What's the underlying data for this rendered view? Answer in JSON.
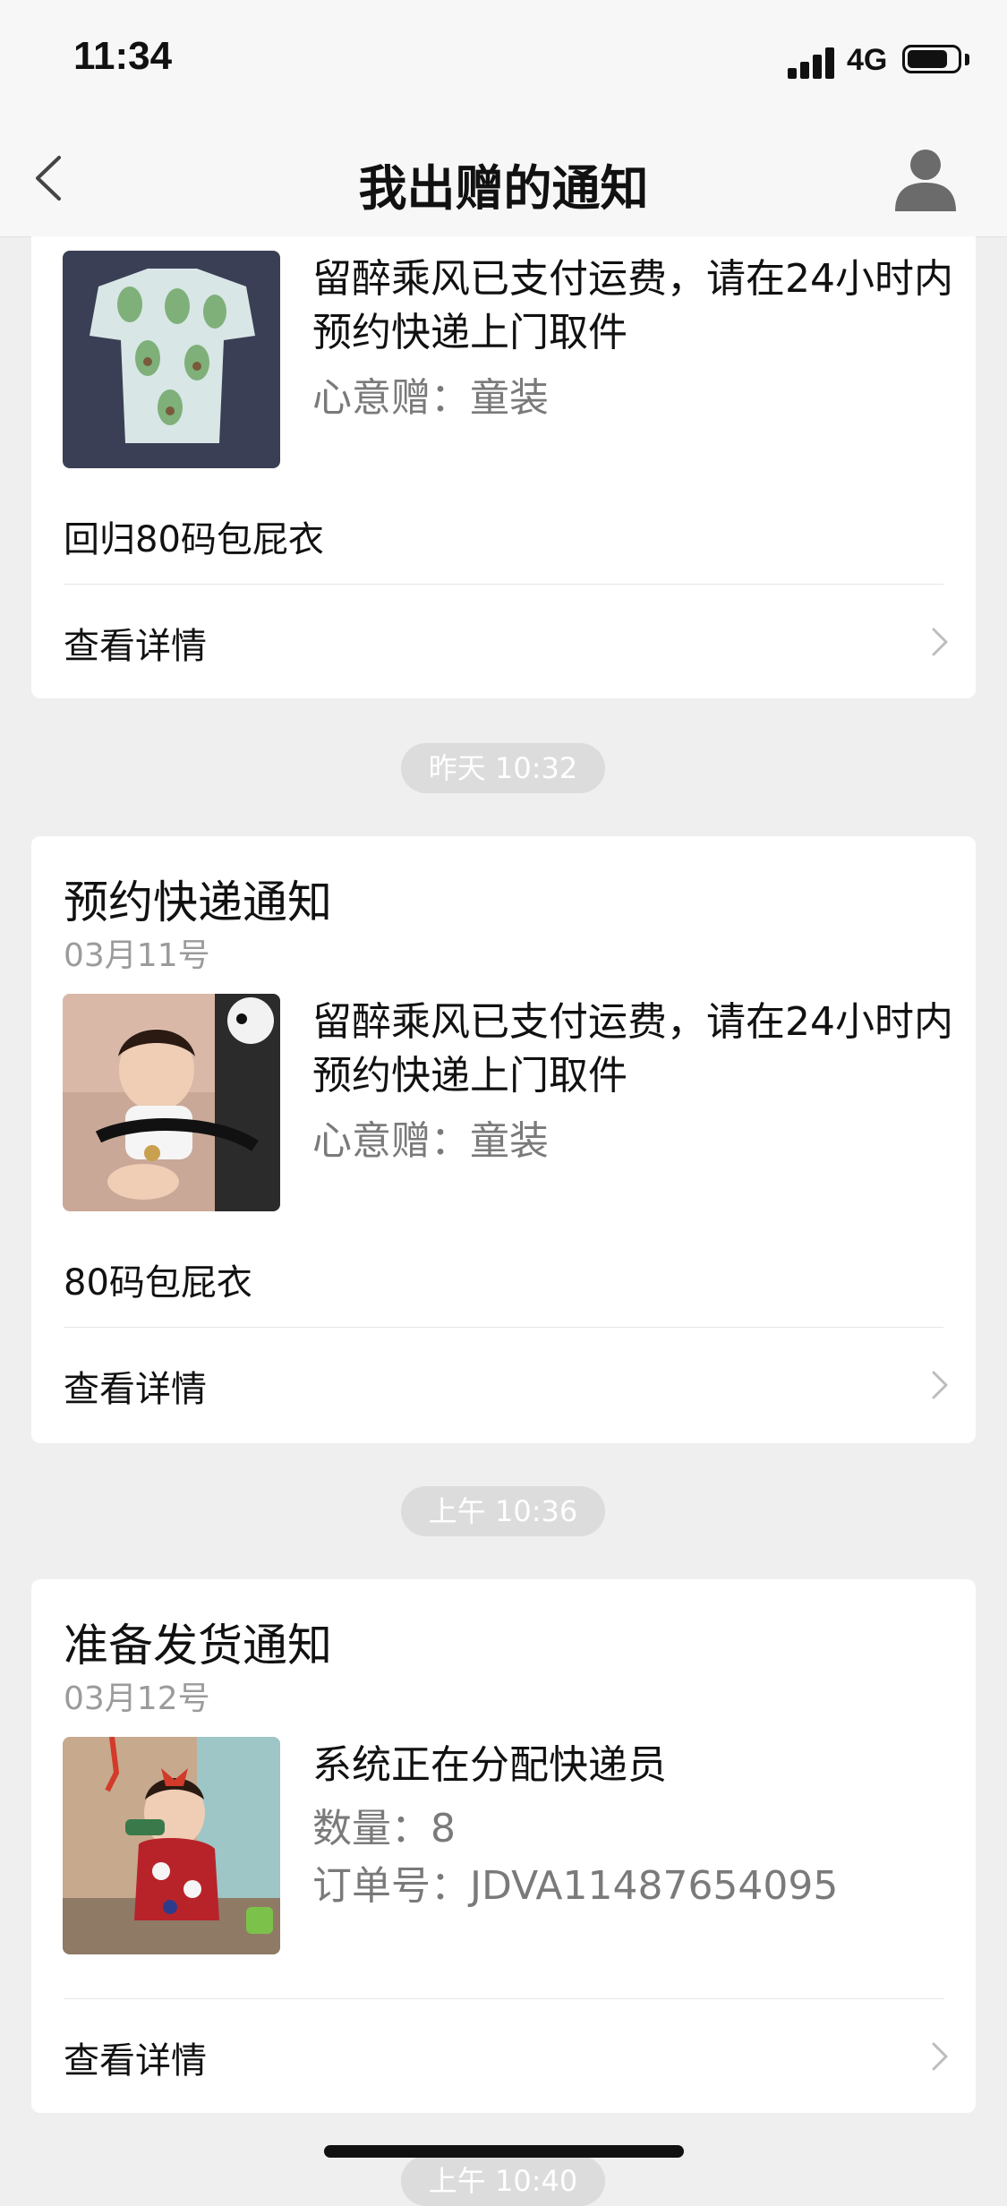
{
  "status": {
    "time": "11:34",
    "network": "4G"
  },
  "nav": {
    "title": "我出赠的通知"
  },
  "cards": [
    {
      "message": "留醉乘风已支付运费，请在24小时内预约快递上门取件",
      "meta": [
        {
          "key": "心意赠：",
          "value": "童装"
        }
      ],
      "item_name": "回归80码包屁衣",
      "detail_label": "查看详情"
    },
    {
      "title": "预约快递通知",
      "date": "03月11号",
      "message": "留醉乘风已支付运费，请在24小时内预约快递上门取件",
      "meta": [
        {
          "key": "心意赠：",
          "value": "童装"
        }
      ],
      "item_name": "80码包屁衣",
      "detail_label": "查看详情"
    },
    {
      "title": "准备发货通知",
      "date": "03月12号",
      "message": "系统正在分配快递员",
      "meta": [
        {
          "key": "数量：",
          "value": "8"
        },
        {
          "key": "订单号：",
          "value": "JDVA11487654095"
        }
      ],
      "detail_label": "查看详情"
    }
  ],
  "time_pills": [
    "昨天 10:32",
    "上午 10:36",
    "上午 10:40"
  ],
  "icons": {
    "back": "chevron-left-icon",
    "profile": "user-icon",
    "detail": "chevron-right-icon"
  },
  "colors": {
    "background": "#efefef",
    "card": "#ffffff",
    "secondary_text": "#9b9b9b",
    "pill": "#dcdcdc"
  }
}
